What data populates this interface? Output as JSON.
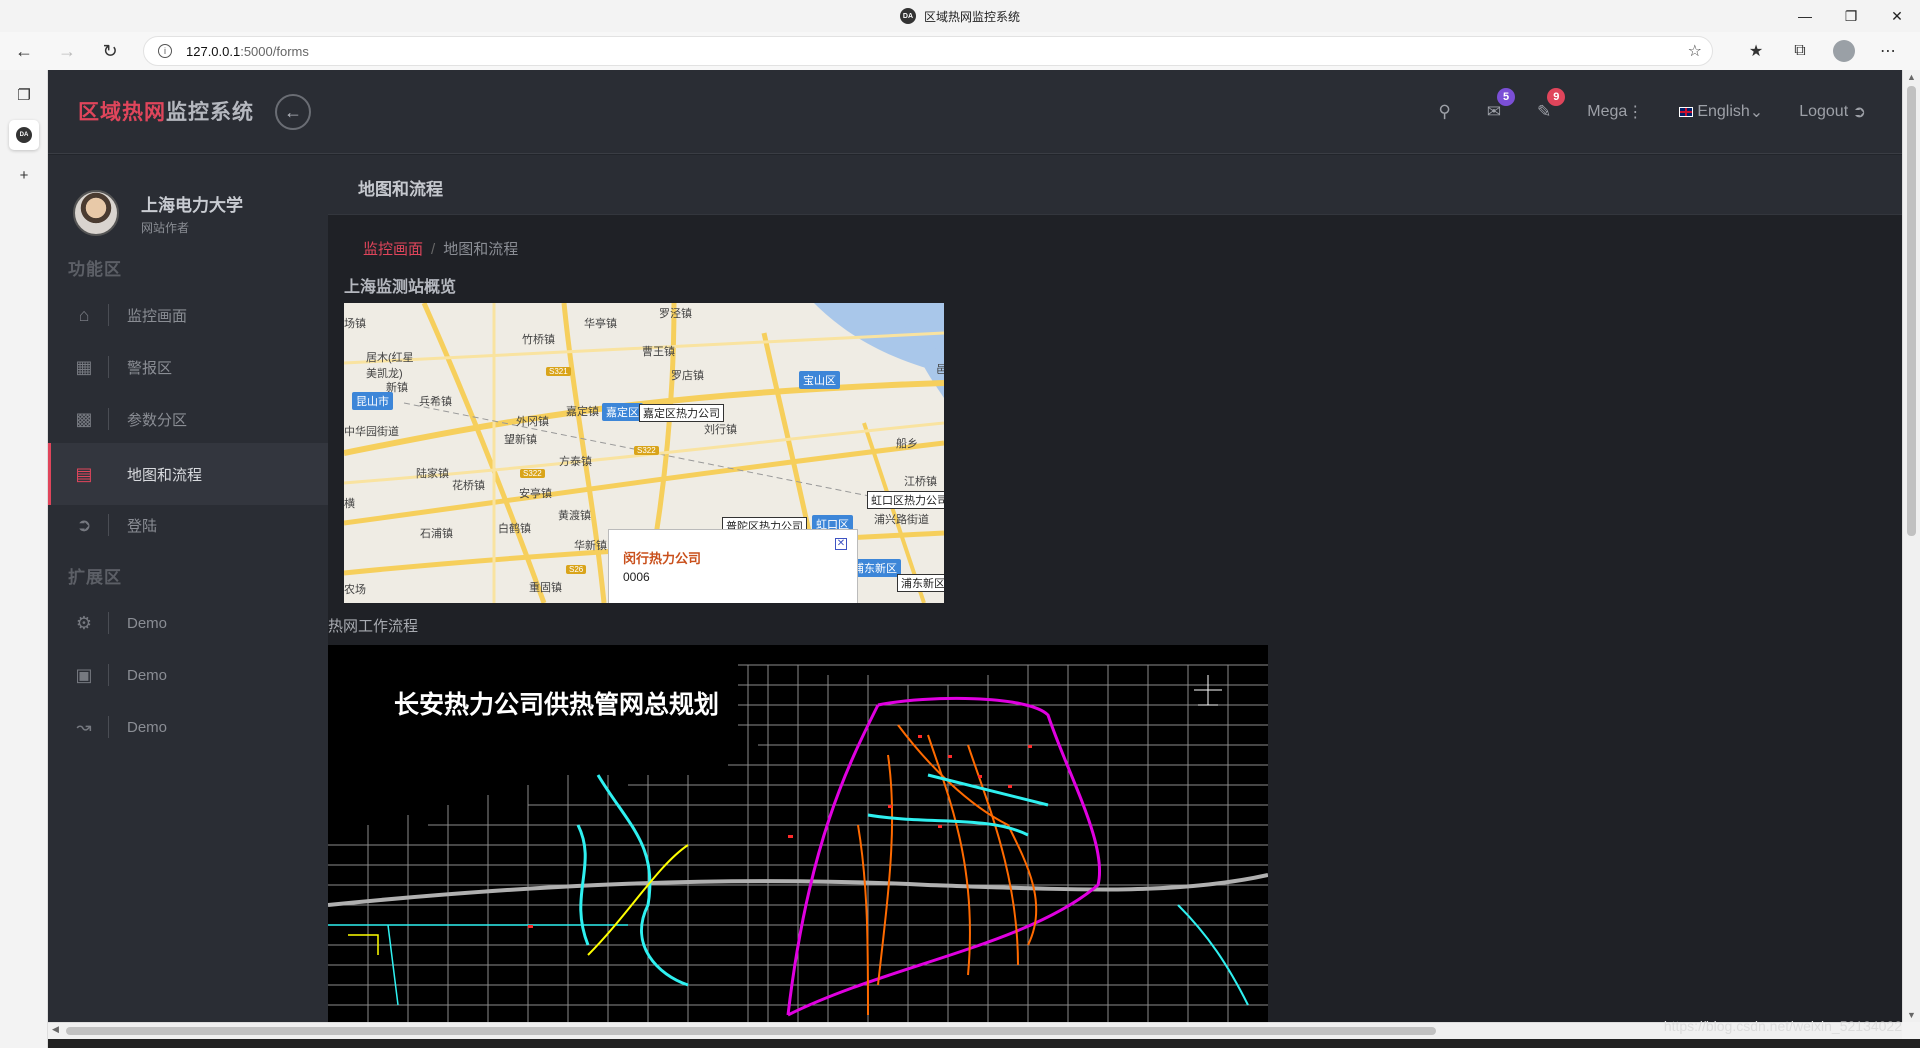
{
  "browser": {
    "tab_title": "区域热网监控系统",
    "favicon_text": "DA",
    "url_host": "127.0.0.1",
    "url_path": ":5000/forms"
  },
  "header": {
    "logo_part1": "区域热网",
    "logo_part2": "监控系统",
    "mail_badge": "5",
    "notif_badge": "9",
    "mega_label": "Mega",
    "language_label": "English",
    "logout_label": "Logout"
  },
  "sidebar": {
    "user_name": "上海电力大学",
    "user_role": "网站作者",
    "section1": "功能区",
    "section2": "扩展区",
    "items": [
      {
        "label": "监控画面",
        "icon": "home-icon"
      },
      {
        "label": "警报区",
        "icon": "grid-icon"
      },
      {
        "label": "参数分区",
        "icon": "bar-chart-icon"
      },
      {
        "label": "地图和流程",
        "icon": "clipboard-icon"
      },
      {
        "label": "登陆",
        "icon": "logout-icon"
      },
      {
        "label": "Demo",
        "icon": "gear-icon"
      },
      {
        "label": "Demo",
        "icon": "presentation-icon"
      },
      {
        "label": "Demo",
        "icon": "line-chart-icon"
      }
    ]
  },
  "main": {
    "page_title": "地图和流程",
    "breadcrumb_home": "监控画面",
    "breadcrumb_current": "地图和流程",
    "map_section_title": "上海监测站概览",
    "flow_section_title": "热网工作流程",
    "plan_title": "长安热力公司供热管网总规划"
  },
  "map": {
    "labels": [
      "场镇",
      "竹桥镇",
      "华亭镇",
      "罗泾镇",
      "居木(红星美凯龙)",
      "曹王镇",
      "罗店镇",
      "新镇",
      "兵希镇",
      "嘉定镇",
      "昆山市",
      "外冈镇",
      "刘行镇",
      "中华园街道",
      "望新镇",
      "方泰镇",
      "陆家镇",
      "花桥镇",
      "安亭镇",
      "黄渡镇",
      "石浦镇",
      "白鹤镇",
      "江桥镇",
      "华新镇",
      "重固镇",
      "农场",
      "浦兴路街道",
      "船乡",
      "横",
      "邑"
    ],
    "districts": [
      "宝山区",
      "嘉定区",
      "昆山市",
      "虹口区",
      "浦东新区"
    ],
    "companies": [
      "嘉定区热力公司",
      "虹口区热力公司",
      "浦东新区",
      "普陀区热力公司"
    ],
    "roads": [
      "S321",
      "S322",
      "S322",
      "S26"
    ],
    "popup_title": "闵行热力公司",
    "popup_value": "0006"
  },
  "watermark": "https://blog.csdn.net/weixin_52134022",
  "colors": {
    "accent": "#e0455b",
    "app_bg": "#22252b",
    "panel_bg": "#2a2d34"
  }
}
